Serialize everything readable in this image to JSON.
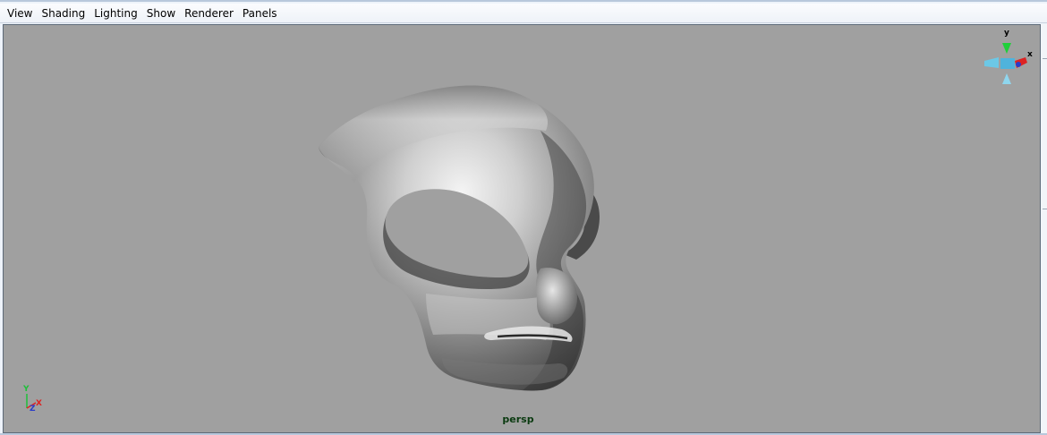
{
  "menubar": {
    "items": [
      "View",
      "Shading",
      "Lighting",
      "Show",
      "Renderer",
      "Panels"
    ]
  },
  "viewport": {
    "camera_label": "persp",
    "background_color": "#a0a0a0",
    "view_cube": {
      "axis_y": "y",
      "axis_x": "x"
    },
    "origin_axes": {
      "axis_y": "Y",
      "axis_x": "X",
      "axis_z": "Z"
    },
    "object": "mask-model"
  }
}
